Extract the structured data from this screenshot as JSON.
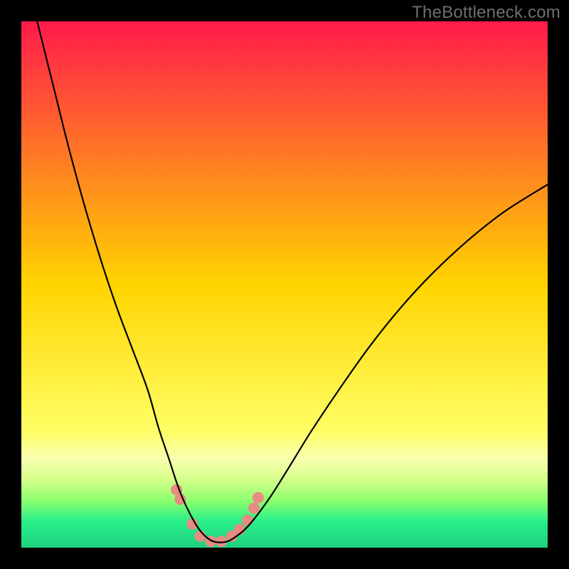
{
  "watermark": "TheBottleneck.com",
  "chart_data": {
    "type": "line",
    "title": "",
    "xlabel": "",
    "ylabel": "",
    "xlim": [
      0,
      100
    ],
    "ylim": [
      0,
      100
    ],
    "background_gradient": {
      "stops": [
        {
          "offset": 0.0,
          "color": "#ff1a4b"
        },
        {
          "offset": 0.5,
          "color": "#ffd400"
        },
        {
          "offset": 0.78,
          "color": "#ffff66"
        },
        {
          "offset": 0.83,
          "color": "#f8ffb0"
        },
        {
          "offset": 0.87,
          "color": "#d6ff8c"
        },
        {
          "offset": 0.91,
          "color": "#8dff6e"
        },
        {
          "offset": 0.95,
          "color": "#28ef8a"
        },
        {
          "offset": 1.0,
          "color": "#1fd07e"
        }
      ]
    },
    "series": [
      {
        "name": "bottleneck-curve",
        "color": "#000000",
        "width": 2.2,
        "x": [
          3,
          6,
          9,
          12,
          15,
          18,
          21,
          24,
          26,
          28,
          30,
          32,
          34,
          36,
          38,
          40,
          43,
          47,
          51,
          55,
          60,
          66,
          72,
          78,
          85,
          92,
          100
        ],
        "y": [
          100,
          88,
          76,
          65,
          55,
          46,
          38,
          30,
          23,
          17,
          11,
          6.5,
          3.2,
          1.4,
          1.0,
          1.6,
          4.0,
          9.2,
          15.5,
          22,
          29.5,
          38,
          45.5,
          52,
          58.5,
          64,
          69
        ]
      }
    ],
    "highlight": {
      "name": "optimal-range-markers",
      "color": "#e78b83",
      "radius": 8,
      "points": [
        {
          "x": 29.5,
          "y": 11.0
        },
        {
          "x": 30.2,
          "y": 9.2
        },
        {
          "x": 32.5,
          "y": 4.5
        },
        {
          "x": 34.0,
          "y": 2.2
        },
        {
          "x": 36.0,
          "y": 1.2
        },
        {
          "x": 38.0,
          "y": 1.2
        },
        {
          "x": 40.0,
          "y": 2.2
        },
        {
          "x": 41.5,
          "y": 3.5
        },
        {
          "x": 43.0,
          "y": 5.2
        },
        {
          "x": 44.2,
          "y": 7.5
        },
        {
          "x": 45.0,
          "y": 9.5
        }
      ]
    }
  }
}
